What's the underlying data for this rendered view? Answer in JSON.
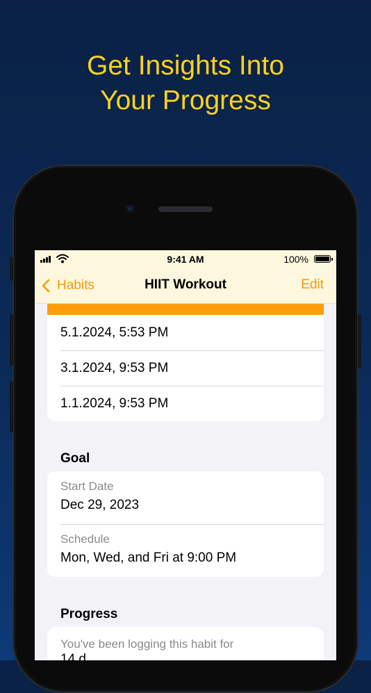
{
  "headline": [
    "Get Insights Into",
    "Your Progress"
  ],
  "statusbar": {
    "time": "9:41 AM",
    "battery": "100%"
  },
  "navbar": {
    "back_label": "Habits",
    "title": "HIIT Workout",
    "edit_label": "Edit"
  },
  "log_entries": [
    "5.1.2024, 5:53 PM",
    "3.1.2024, 9:53 PM",
    "1.1.2024, 9:53 PM"
  ],
  "goal": {
    "title": "Goal",
    "start_date_label": "Start Date",
    "start_date_value": "Dec 29, 2023",
    "schedule_label": "Schedule",
    "schedule_value": "Mon, Wed, and Fri at 9:00 PM"
  },
  "progress": {
    "title": "Progress",
    "text": "You've been logging this habit for",
    "text_cut": "14 d"
  },
  "colors": {
    "accent": "#f59b0a",
    "headline": "#ffd21a",
    "strip": "#ff9d0a"
  },
  "icons": [
    "chevron-left-icon",
    "cellular-signal-icon",
    "wifi-icon",
    "battery-icon"
  ]
}
